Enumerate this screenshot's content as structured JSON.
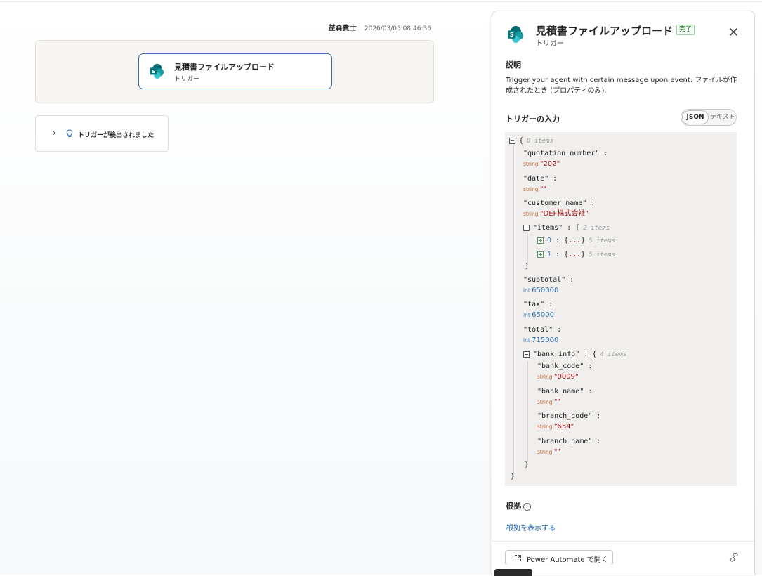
{
  "message": {
    "user": "益森貴士",
    "timestamp": "2026/03/05 08:46:36"
  },
  "trigger_card": {
    "title": "見積書ファイルアップロード",
    "subtitle": "トリガー",
    "icon": "sharepoint-icon"
  },
  "detected": {
    "label": "トリガーが検出されました",
    "icons": [
      "chevron-right-icon",
      "lightbulb-icon"
    ]
  },
  "panel": {
    "title": "見積書ファイルアップロード",
    "badge": "完了",
    "subtitle": "トリガー",
    "description_heading": "説明",
    "description": "Trigger your agent with certain message upon event: ファイルが作成されたとき (プロパティのみ).",
    "inputs_heading": "トリガーの入力",
    "toggle": {
      "json_label": "JSON",
      "text_label": "テキスト",
      "selected": "JSON"
    },
    "basis_heading": "根拠",
    "basis_link": "根拠を表示する",
    "open_button": "Power Automate で開く",
    "colors": {
      "accent": "#1f5fa5",
      "badge_green": "#0e700e",
      "string": "#a31515",
      "int": "#2f6fb0"
    }
  },
  "json_tree": {
    "root_count": "8 items",
    "quotation_number_key": "\"quotation_number\"",
    "quotation_number_type": "string",
    "quotation_number_val": "\"202\"",
    "date_key": "\"date\"",
    "date_type": "string",
    "date_val": "\"\"",
    "customer_name_key": "\"customer_name\"",
    "customer_name_type": "string",
    "customer_name_val": "\"DEF株式会社\"",
    "items_key": "\"items\"",
    "items_count": "2 items",
    "item0_idx": "0",
    "item0_count": "5 items",
    "item1_idx": "1",
    "item1_count": "5 items",
    "subtotal_key": "\"subtotal\"",
    "subtotal_type": "int",
    "subtotal_val": "650000",
    "tax_key": "\"tax\"",
    "tax_type": "int",
    "tax_val": "65000",
    "total_key": "\"total\"",
    "total_type": "int",
    "total_val": "715000",
    "bank_info_key": "\"bank_info\"",
    "bank_info_count": "4 items",
    "bank_code_key": "\"bank_code\"",
    "bank_code_type": "string",
    "bank_code_val": "\"0009\"",
    "bank_name_key": "\"bank_name\"",
    "bank_name_type": "string",
    "bank_name_val": "\"\"",
    "branch_code_key": "\"branch_code\"",
    "branch_code_type": "string",
    "branch_code_val": "\"654\"",
    "branch_name_key": "\"branch_name\"",
    "branch_name_type": "string",
    "branch_name_val": "\"\""
  }
}
